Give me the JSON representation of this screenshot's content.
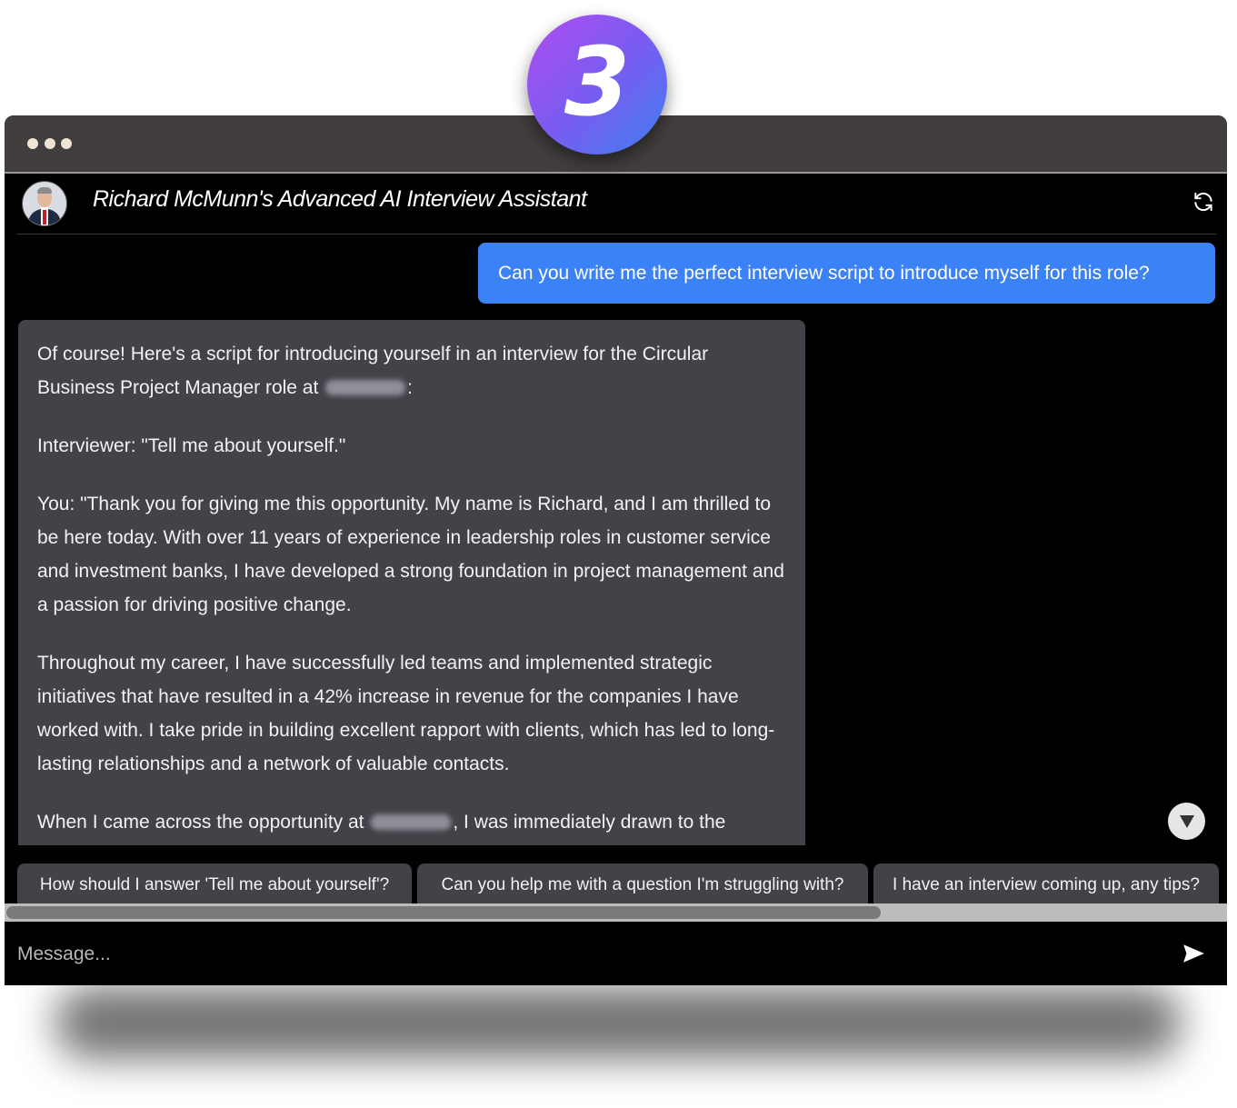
{
  "step_badge": "3",
  "chat": {
    "title": "Richard McMunn's Advanced AI Interview Assistant",
    "user_message": "Can you write me the perfect interview script to introduce myself for this role?",
    "assistant_paragraphs": [
      {
        "before": "Of course! Here's a script for introducing yourself in an interview for the Circular Business Project Manager role at ",
        "after": ":"
      },
      {
        "text": "Interviewer: \"Tell me about yourself.\""
      },
      {
        "text": "You: \"Thank you for giving me this opportunity. My name is Richard, and I am thrilled to be here today. With over 11 years of experience in leadership roles in customer service and investment banks, I have developed a strong foundation in project management and a passion for driving positive change."
      },
      {
        "text": "Throughout my career, I have successfully led teams and implemented strategic initiatives that have resulted in a 42% increase in revenue for the companies I have worked with. I take pride in building excellent rapport with clients, which has led to long-lasting relationships and a network of valuable contacts."
      },
      {
        "before": "When I came across the opportunity at ",
        "after": ", I was immediately drawn to the"
      }
    ]
  },
  "suggestions": [
    "How should I answer 'Tell me about yourself'?",
    "Can you help me with a question I'm struggling with?",
    "I have an interview coming up, any tips?"
  ],
  "composer": {
    "placeholder": "Message...",
    "value": ""
  },
  "icons": {
    "refresh": "refresh-icon",
    "send": "send-icon",
    "scroll_down": "chevron-down-icon"
  },
  "colors": {
    "user_bubble": "#3b82f6",
    "assistant_bubble": "#424249",
    "titlebar": "#423e3e",
    "badge_gradient_start": "#b04cf0",
    "badge_gradient_end": "#3f7ef0"
  },
  "horizontal_scroll_fraction": 0.72
}
